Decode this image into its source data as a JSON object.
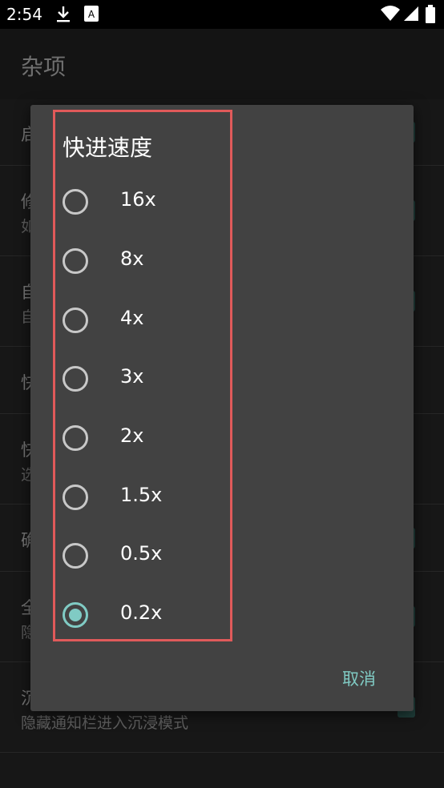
{
  "status_bar": {
    "time": "2:54",
    "icons": [
      "download-icon",
      "a-box-icon",
      "wifi-icon",
      "signal-icon",
      "battery-icon"
    ]
  },
  "app_bar": {
    "title": "杂项"
  },
  "settings_rows": [
    {
      "title": "启",
      "subtitle": ""
    },
    {
      "title": "修",
      "subtitle": "如"
    },
    {
      "title": "自",
      "subtitle": "自"
    },
    {
      "title": "快",
      "subtitle": ""
    },
    {
      "title": "快",
      "subtitle": "选"
    },
    {
      "title": "确",
      "subtitle": ""
    },
    {
      "title": "全",
      "subtitle": "隐"
    },
    {
      "title": "沉",
      "subtitle": "隐藏通知栏进入沉浸模式"
    }
  ],
  "dialog": {
    "title": "快进速度",
    "options": [
      {
        "label": "16x",
        "selected": false
      },
      {
        "label": "8x",
        "selected": false
      },
      {
        "label": "4x",
        "selected": false
      },
      {
        "label": "3x",
        "selected": false
      },
      {
        "label": "2x",
        "selected": false
      },
      {
        "label": "1.5x",
        "selected": false
      },
      {
        "label": "0.5x",
        "selected": false
      },
      {
        "label": "0.2x",
        "selected": true
      }
    ],
    "cancel_label": "取消"
  },
  "colors": {
    "accent": "#80cbc4",
    "dialog_bg": "#424242",
    "highlight_border": "#e05a5a"
  }
}
